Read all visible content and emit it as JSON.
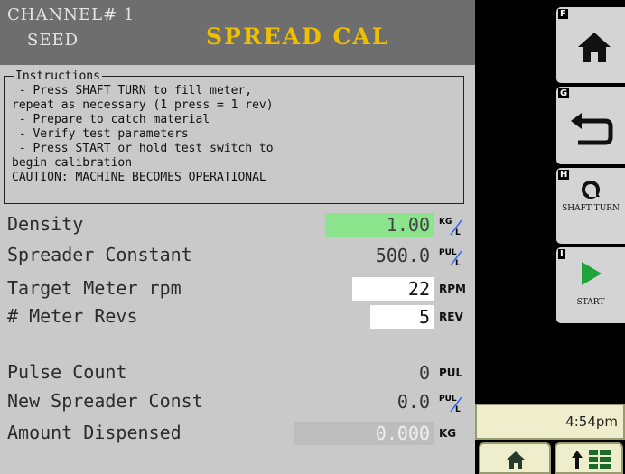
{
  "header": {
    "channel_line1": "CHANNEL# 1",
    "channel_line2": "SEED",
    "title": "SPREAD CAL"
  },
  "instructions": {
    "legend": "Instructions",
    "lines": [
      " - Press SHAFT TURN to fill meter,",
      "repeat as necessary (1 press = 1 rev)",
      " - Prepare to catch material",
      " - Verify test parameters",
      " - Press START or hold test switch to",
      "begin calibration",
      "CAUTION: MACHINE BECOMES OPERATIONAL"
    ]
  },
  "params": [
    {
      "label": "Density",
      "value": "1.00",
      "unit": "KG/L"
    },
    {
      "label": "Spreader Constant",
      "value": "500.0",
      "unit": "PUL/L"
    },
    {
      "label": "Target Meter rpm",
      "value": "22",
      "unit": "RPM"
    },
    {
      "label": "# Meter Revs",
      "value": "5",
      "unit": "REV"
    },
    {
      "label": "Pulse Count",
      "value": "0",
      "unit": "PUL"
    },
    {
      "label": "New Spreader Const",
      "value": "0.0",
      "unit": "PUL/L"
    },
    {
      "label": "Amount Dispensed",
      "value": "0.000",
      "unit": "KG"
    }
  ],
  "softkeys": [
    {
      "key": "F",
      "icon": "home-icon",
      "label": ""
    },
    {
      "key": "G",
      "icon": "back-arrow-icon",
      "label": ""
    },
    {
      "key": "H",
      "icon": "shaft-turn-icon",
      "label": "SHAFT TURN"
    },
    {
      "key": "I",
      "icon": "play-icon",
      "label": "START"
    }
  ],
  "status": {
    "time": "4:54pm"
  },
  "colors": {
    "title": "#f0c000",
    "highlight": "#8ce58c",
    "start_green": "#1fa33a"
  }
}
